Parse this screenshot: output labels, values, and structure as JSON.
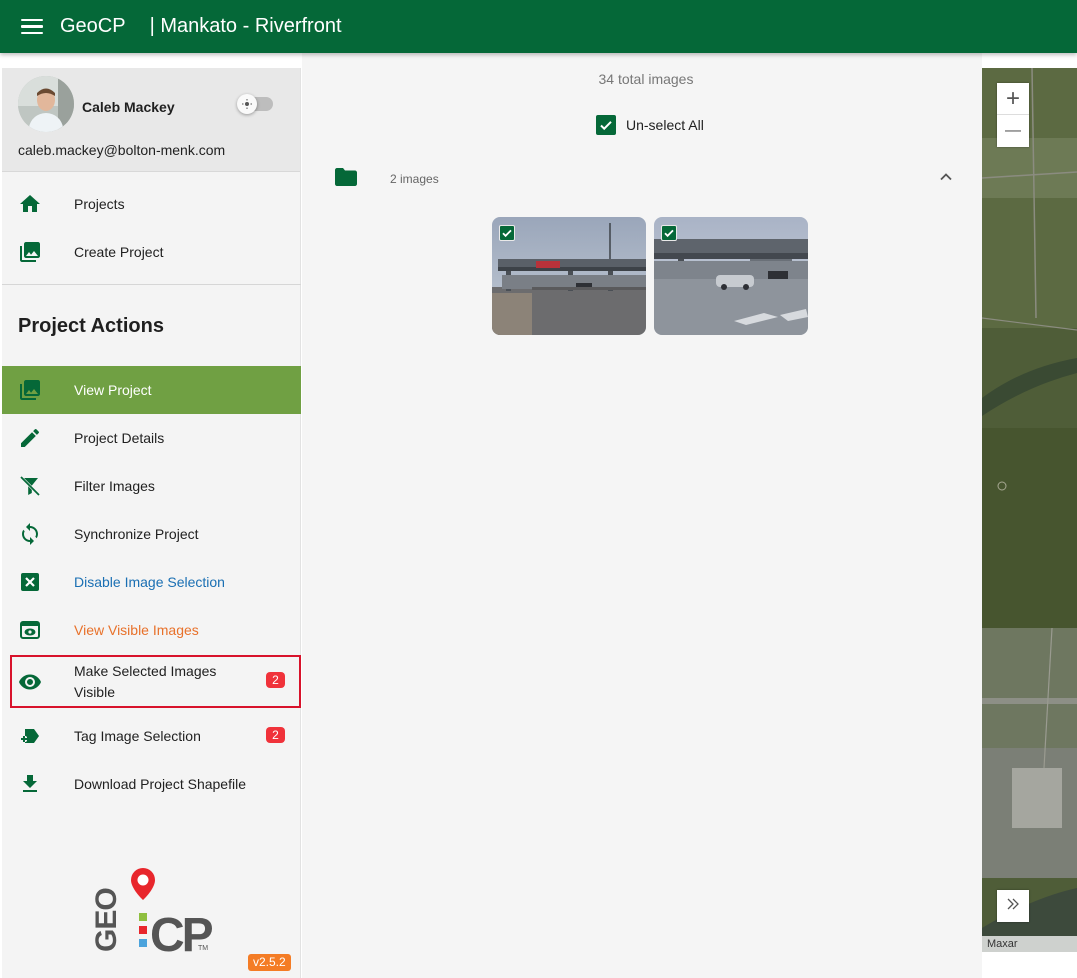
{
  "appbar": {
    "app_name": "GeoCP",
    "project_name": "| Mankato - Riverfront"
  },
  "profile": {
    "name": "Caleb Mackey",
    "email": "caleb.mackey@bolton-menk.com"
  },
  "nav": {
    "items": [
      {
        "label": "Projects",
        "icon": "home-icon"
      },
      {
        "label": "Create Project",
        "icon": "photo-library-icon"
      }
    ]
  },
  "project_actions": {
    "title": "Project Actions",
    "items": [
      {
        "label": "View Project",
        "icon": "photo-library-icon",
        "active": true
      },
      {
        "label": "Project Details",
        "icon": "pencil-icon"
      },
      {
        "label": "Filter Images",
        "icon": "filter-off-icon"
      },
      {
        "label": "Synchronize Project",
        "icon": "sync-icon"
      },
      {
        "label": "Disable Image Selection",
        "icon": "close-box-icon",
        "color": "#1a6fb3"
      },
      {
        "label": "View Visible Images",
        "icon": "eye-box-icon",
        "color": "#e8712a"
      },
      {
        "label": "Make Selected Images\nVisible",
        "icon": "eye-icon",
        "badge": "2"
      },
      {
        "label": "Tag Image Selection",
        "icon": "tag-plus-icon",
        "badge": "2"
      },
      {
        "label": "Download Project Shapefile",
        "icon": "download-icon"
      }
    ]
  },
  "version": "v2.5.2",
  "logo": {
    "text": "GEO:CP",
    "trademark": "TM"
  },
  "main": {
    "total_images": "34 total images",
    "unselect_all_label": "Un-select All",
    "folder_count": "2 images",
    "thumbnails": [
      {
        "name": "overpass-street-view-1",
        "selected": true
      },
      {
        "name": "overpass-street-view-2",
        "selected": true
      }
    ]
  },
  "map": {
    "zoom_in": "+",
    "zoom_out": "—",
    "attribution": "Maxar"
  },
  "colors": {
    "brand_green": "#056838",
    "active_item": "#70a043",
    "badge": "#f0323a",
    "version_badge": "#f47c25",
    "link_blue": "#1a6fb3",
    "link_orange": "#e8712a"
  }
}
